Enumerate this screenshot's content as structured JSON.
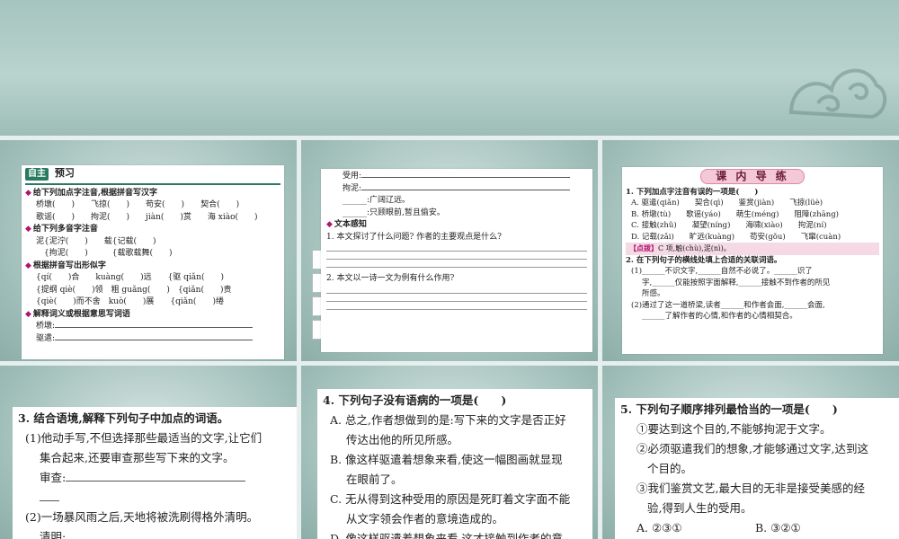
{
  "slide1": {
    "badge": "自主",
    "title": "预习",
    "s1": "给下列加点字注音,根据拼音写汉字",
    "s1_r1": "桥墩(　　)　　飞掠(　　)　　苟安(　　)　　契合(　　)",
    "s1_r2": "歌谣(　　)　　拘泥(　　)　　jiàn(　　)赏　　海 xiào(　　)",
    "s2": "给下列多音字注音",
    "s2_r1": "泥{泥泞(　　)　　载{记载(　　)",
    "s2_r2": "　{拘泥(　　)　　　{载歌载舞(　　)",
    "s3": "根据拼音写出形似字",
    "s3_r1": "{qí(　　)合　　kuàng(　　)远　　{驱 qiǎn(　　)",
    "s3_r2": "{提纲 qiè(　　)领　粗 guǎng(　　)　{qiǎn(　　)责",
    "s3_r3": "{qiè(　　)而不舍　kuò(　　)展　　{qiǎn(　　)绻",
    "s4": "解释词义或根据意思写词语",
    "s4_r1": "桥墩:",
    "s4_r2": "驱遣:"
  },
  "slide2": {
    "r1": "受用:",
    "r2": "拘泥:",
    "r3": "______:广阔辽远。",
    "r4": "______:只顾眼前,暂且偷安。",
    "sec": "文本感知",
    "q1": "1. 本文探讨了什么问题? 作者的主要观点是什么?",
    "q2": "2. 本文以一诗一文为例有什么作用?"
  },
  "slide3": {
    "banner": "课 内 导 练",
    "q1": "1. 下列加点字注音有误的一项是(　　)",
    "a": "A. 驱遣(qiǎn)　　契合(qì)　　鉴赏(jiàn)　　飞掠(lüè)",
    "b": "B. 桥墩(tù)　　歌谣(yáo)　　萌生(méng)　　阻障(zhāng)",
    "c": "C. 接触(zhǔ)　　凝望(níng)　　海啸(xiào)　　拘泥(ní)",
    "d": "D. 记载(zǎi)　　旷远(kuàng)　　苟安(gǒu)　　飞窜(cuàn)",
    "hint_label": "【点拨】",
    "hint": "C 项,触(chù),泥(nì)。",
    "q2": "2. 在下列句子的横线处填上合适的关联词语。",
    "q2_1": "(1)______不识文字,______自然不必说了。______识了",
    "q2_1b": "字,______仅能按照字面解释,______接触不到作者的所见",
    "q2_1c": "所感。",
    "q2_2": "(2)通过了这一道桥梁,读者______和作者会面,______会面,",
    "q2_2b": "______了解作者的心情,和作者的心情相契合。"
  },
  "slide4": {
    "q": "3. 结合语境,解释下列句子中加点的词语。",
    "p1a": "(1)他动手写,不但选择那些最适当的文字,让它们",
    "p1b": "集合起来,还要审查那些写下来的文字。",
    "p1c": "审查:",
    "p2a": "(2)一场暴风雨之后,天地将被洗刷得格外清明。",
    "p2b": "清明:"
  },
  "slide5": {
    "q": "4. 下列句子没有语病的一项是(　　)",
    "a1": "A. 总之,作者想做到的是:写下来的文字是否正好",
    "a2": "传达出他的所见所感。",
    "b1": "B. 像这样驱遣着想象来看,使这一幅图画就显现",
    "b2": "在眼前了。",
    "c1": "C. 无从得到这种受用的原因是死盯着文字面不能",
    "c2": "从文字领会作者的意境造成的。",
    "d1": "D. 像这样驱遣着想象来看,这才接触到作者的意"
  },
  "slide6": {
    "q": "5. 下列句子顺序排列最恰当的一项是(　　)",
    "s1": "①要达到这个目的,不能够拘泥于文字。",
    "s2a": "②必须驱遣我们的想象,才能够通过文字,达到这",
    "s2b": "个目的。",
    "s3a": "③我们鉴赏文艺,最大目的无非是接受美感的经",
    "s3b": "验,得到人生的受用。",
    "optA": "A. ②③①",
    "optB": "B. ③②①"
  },
  "colors": {
    "background": "#8fb3ae",
    "header_green": "#2a7a62",
    "accent_magenta": "#b0136f",
    "banner_pink": "#f4c8d6"
  }
}
